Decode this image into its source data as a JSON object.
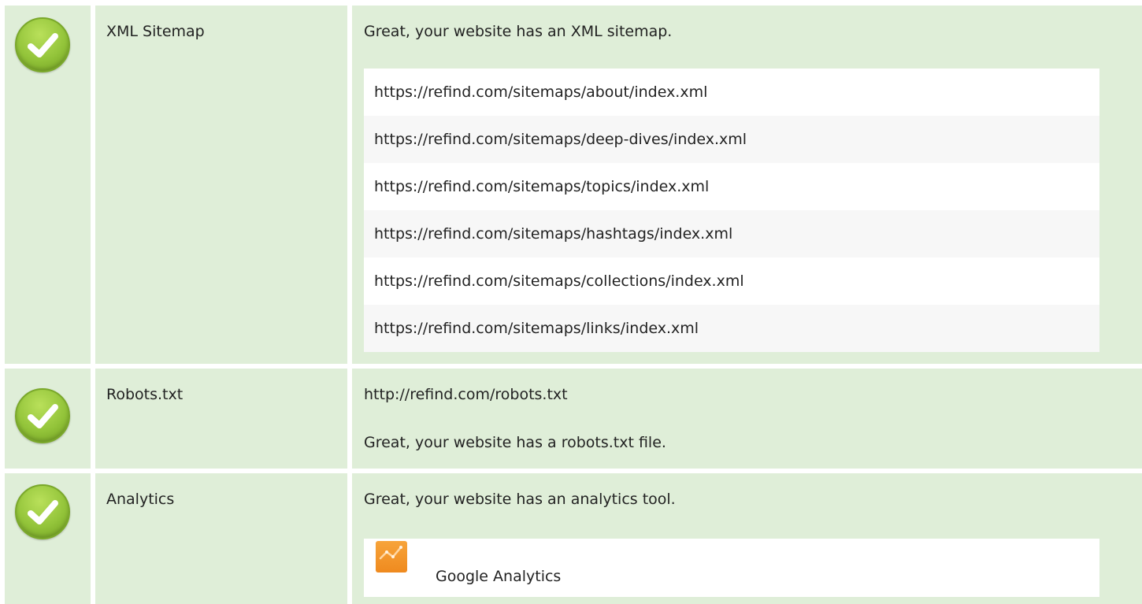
{
  "checks": {
    "sitemap": {
      "label": "XML Sitemap",
      "status_text": "Great, your website has an XML sitemap.",
      "urls": [
        "https://refind.com/sitemaps/about/index.xml",
        "https://refind.com/sitemaps/deep-dives/index.xml",
        "https://refind.com/sitemaps/topics/index.xml",
        "https://refind.com/sitemaps/hashtags/index.xml",
        "https://refind.com/sitemaps/collections/index.xml",
        "https://refind.com/sitemaps/links/index.xml"
      ]
    },
    "robots": {
      "label": "Robots.txt",
      "url": "http://refind.com/robots.txt",
      "status_text": "Great, your website has a robots.txt file."
    },
    "analytics": {
      "label": "Analytics",
      "status_text": "Great, your website has an analytics tool.",
      "tool_name": "Google Analytics",
      "tool_icon": "google-analytics-icon"
    }
  },
  "status_icon": "check-circle-icon",
  "colors": {
    "row_background": "#dfeed8",
    "success_green": "#93c43a",
    "analytics_orange": "#f39a2c"
  }
}
